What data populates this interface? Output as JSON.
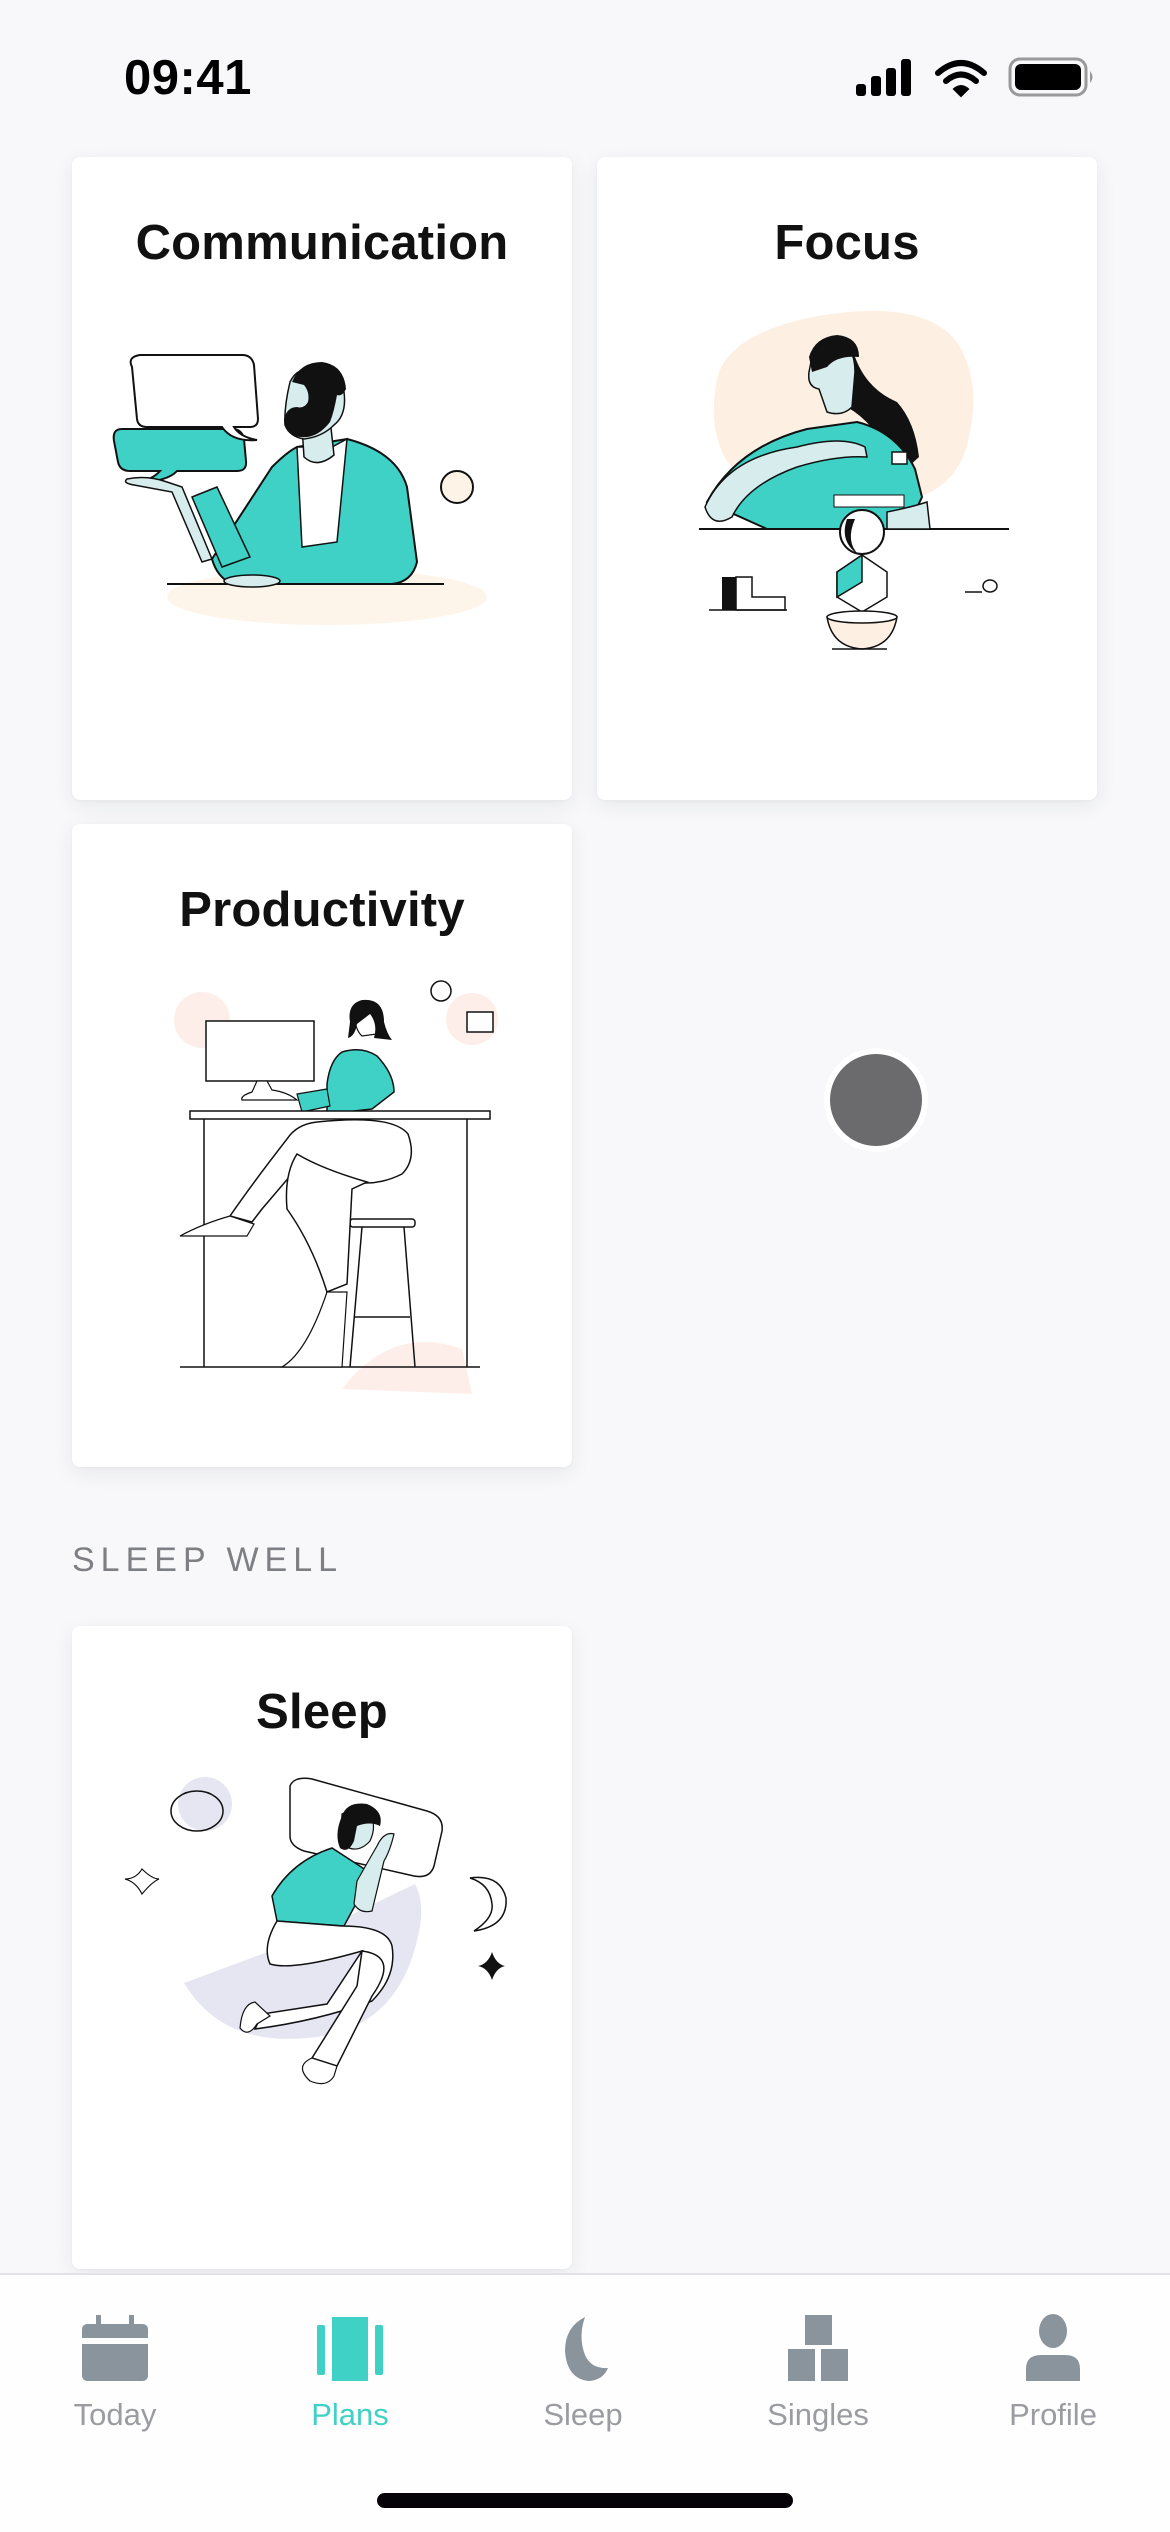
{
  "status_bar": {
    "time": "09:41",
    "icons": [
      "cellular-signal-icon",
      "wifi-icon",
      "battery-icon"
    ]
  },
  "plans": [
    {
      "title": "Communication",
      "illustration": "man-talking-speech-bubbles"
    },
    {
      "title": "Focus",
      "illustration": "woman-stacking-blocks"
    },
    {
      "title": "Productivity",
      "illustration": "woman-at-desk-computer"
    }
  ],
  "sections": [
    {
      "label": "SLEEP WELL",
      "plans": [
        {
          "title": "Sleep",
          "illustration": "man-sleeping-on-pillow"
        }
      ]
    }
  ],
  "tab_bar": {
    "active": "Plans",
    "tabs": [
      {
        "label": "Today",
        "icon": "calendar-icon"
      },
      {
        "label": "Plans",
        "icon": "plans-cards-icon"
      },
      {
        "label": "Sleep",
        "icon": "moon-icon"
      },
      {
        "label": "Singles",
        "icon": "blocks-icon"
      },
      {
        "label": "Profile",
        "icon": "person-icon"
      }
    ]
  },
  "colors": {
    "accent": "#3fd1c5",
    "inactive": "#8a949c",
    "background": "#f8f8fa",
    "skin": "#d7eced",
    "peach": "#fdf0e3",
    "lavender": "#e6e5f2"
  }
}
